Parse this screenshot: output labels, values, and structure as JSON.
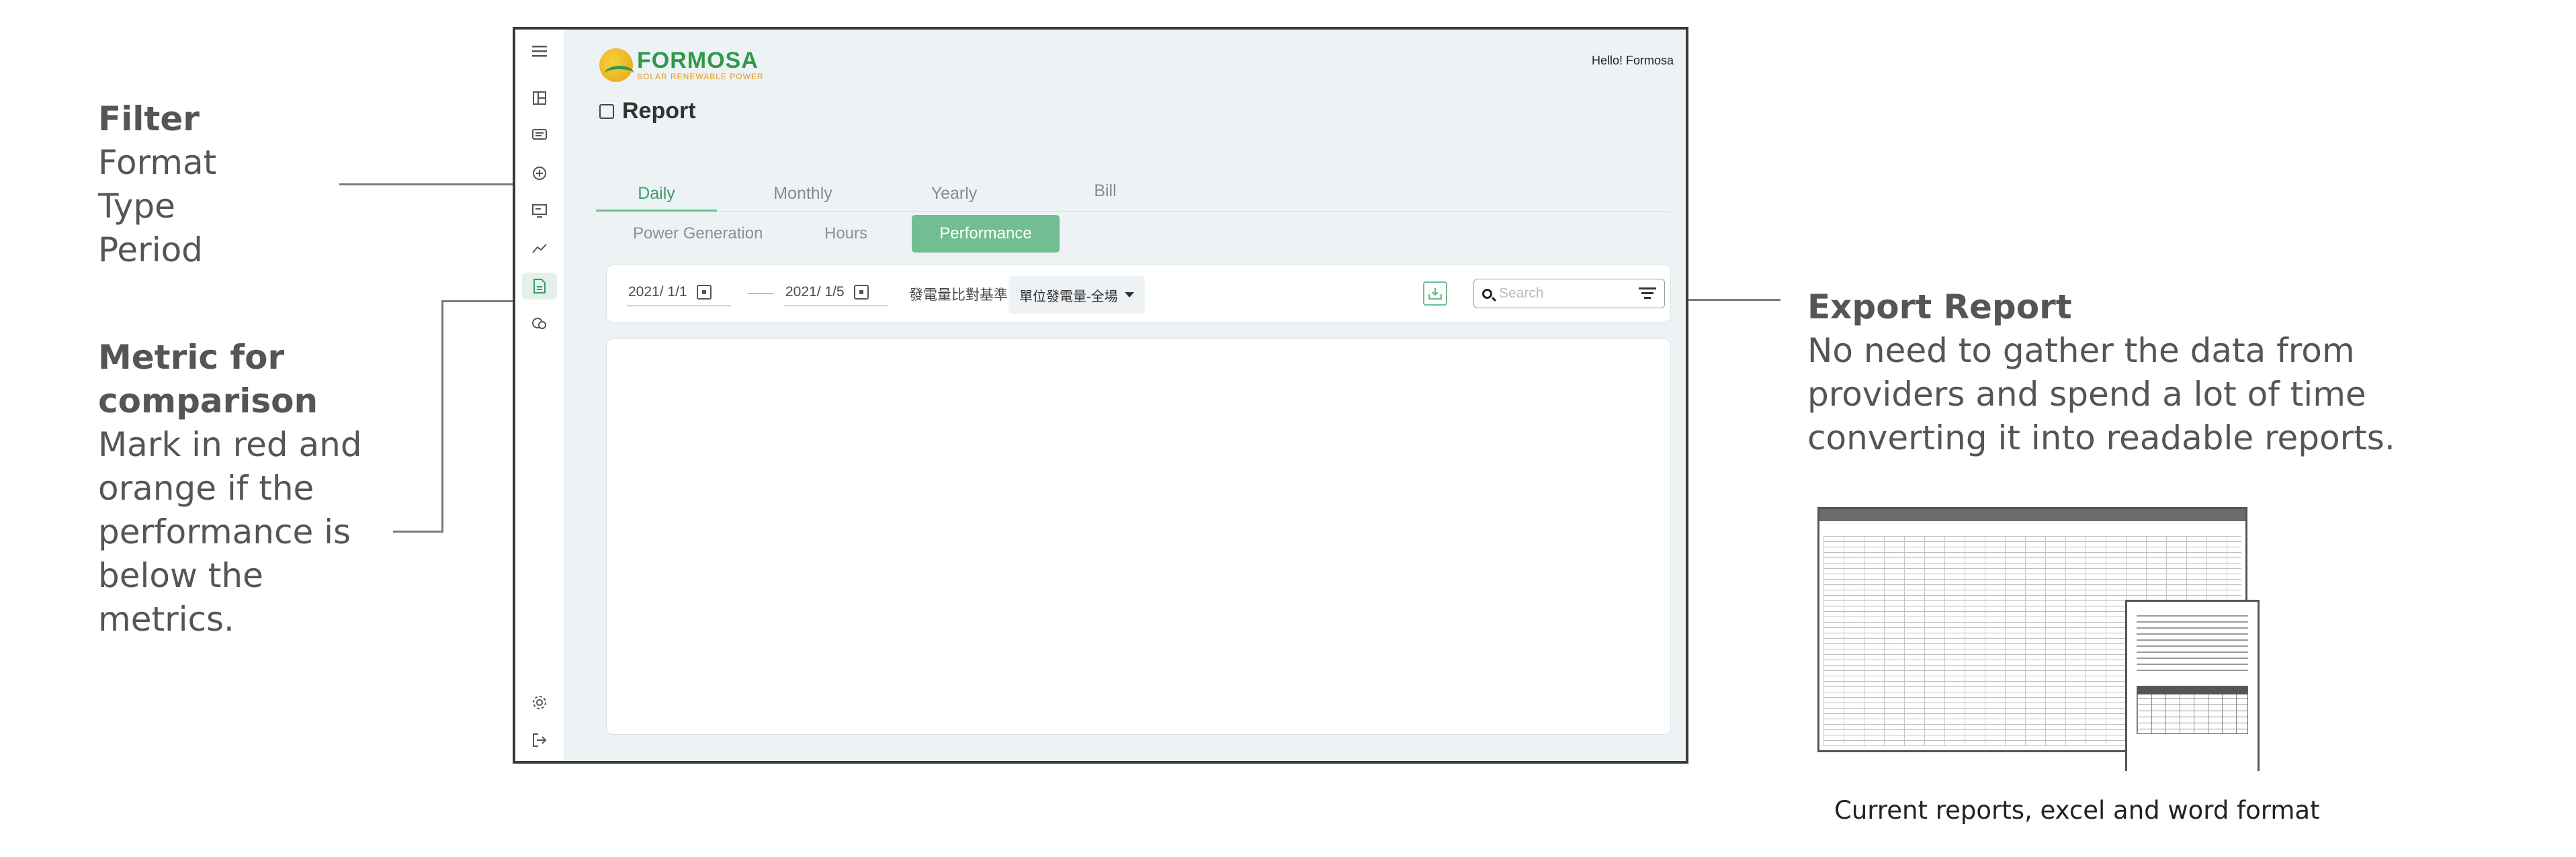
{
  "annotations": {
    "filter": {
      "title": "Filter",
      "lines": [
        "Format",
        "Type",
        "Period"
      ]
    },
    "metric": {
      "title_lines": [
        "Metric for",
        "comparison"
      ],
      "lines": [
        "Mark in red and",
        "orange if the",
        "performance is",
        "below the",
        "metrics."
      ]
    },
    "export": {
      "title": "Export Report",
      "lines": [
        "No need to gather the data from",
        "providers and spend a lot of time",
        "converting it into readable reports."
      ]
    },
    "caption": "Current reports, excel and word format"
  },
  "app": {
    "brand": {
      "name": "FORMOSA",
      "tagline": "SOLAR RENEWABLE POWER"
    },
    "greeting": "Hello! Formosa",
    "page_title": "Report",
    "tabs": [
      {
        "label": "Daily",
        "active": true
      },
      {
        "label": "Monthly",
        "active": false
      },
      {
        "label": "Yearly",
        "active": false
      },
      {
        "label": "Bill",
        "active": false
      }
    ],
    "subtabs": [
      {
        "label": "Power Generation",
        "active": false
      },
      {
        "label": "Hours",
        "active": false
      },
      {
        "label": "Performance",
        "active": true
      }
    ],
    "filters": {
      "start_date": "2021/ 1/1",
      "end_date": "2021/ 1/5",
      "metric_label": "發電量比對基準",
      "metric_select": "單位發電量-全場",
      "search_placeholder": "Search"
    },
    "rail_icons": [
      "menu-icon",
      "dashboard-icon",
      "message-icon",
      "plus-circle-icon",
      "monitor-icon",
      "trend-icon",
      "report-icon",
      "chat-icon",
      "settings-icon",
      "logout-icon"
    ],
    "colors": {
      "accent": "#6dbf93",
      "accent_text": "#3f9c6d",
      "brand_green": "#2e9a4a",
      "brand_orange": "#e59a1a"
    }
  }
}
